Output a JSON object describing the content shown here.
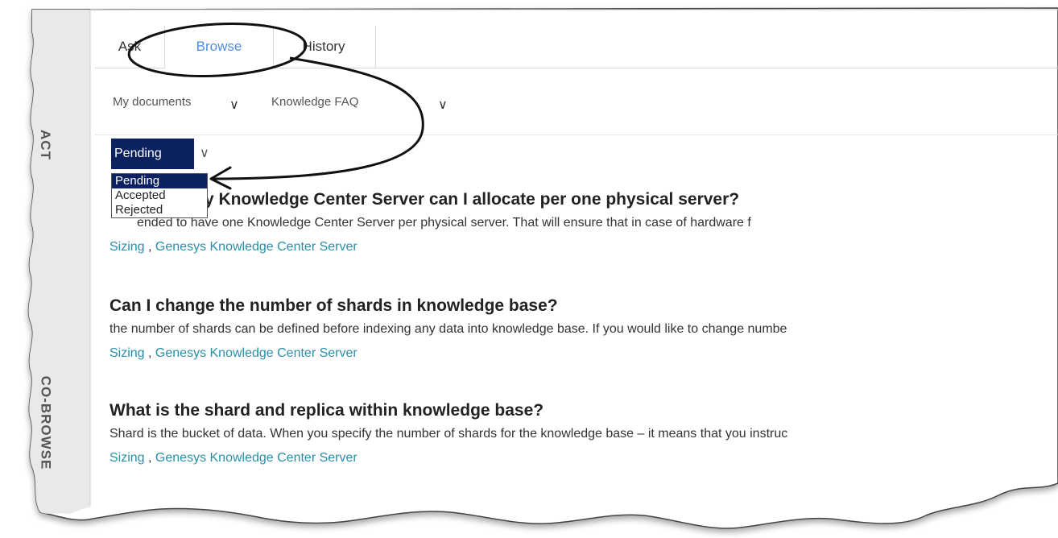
{
  "side_tabs": {
    "contact": "ACT",
    "cobrowse": "CO-BROWSE"
  },
  "tabs": [
    {
      "label": "Ask"
    },
    {
      "label": "Browse",
      "active": true
    },
    {
      "label": "History"
    }
  ],
  "filters": {
    "documents": "My documents",
    "knowledge_base": "Knowledge FAQ"
  },
  "status": {
    "selected": "Pending",
    "options": [
      "Pending",
      "Accepted",
      "Rejected"
    ]
  },
  "articles": [
    {
      "title": "y Knowledge Center Server can I allocate per one physical server?",
      "snippet": "ended to have one Knowledge Center Server per physical server. That will ensure that in case of hardware f",
      "tags": [
        "Sizing",
        "Genesys Knowledge Center Server"
      ]
    },
    {
      "title": "Can I change the number of shards in knowledge base?",
      "snippet": "the number of shards can be defined before indexing any data into knowledge base. If you would like to change numbe",
      "tags": [
        "Sizing",
        "Genesys Knowledge Center Server"
      ]
    },
    {
      "title": "What is the shard and replica within knowledge base?",
      "snippet": "Shard is the bucket of data. When you specify the number of shards for the knowledge base – it means that you instruc",
      "tags": [
        "Sizing",
        "Genesys Knowledge Center Server"
      ]
    }
  ],
  "icons": {
    "chevron": "chevron-down-icon"
  },
  "colors": {
    "accent": "#4f8ee0",
    "selected_bg": "#0c2260",
    "tag": "#2a8fa8",
    "rail": "#e9e9e9"
  }
}
